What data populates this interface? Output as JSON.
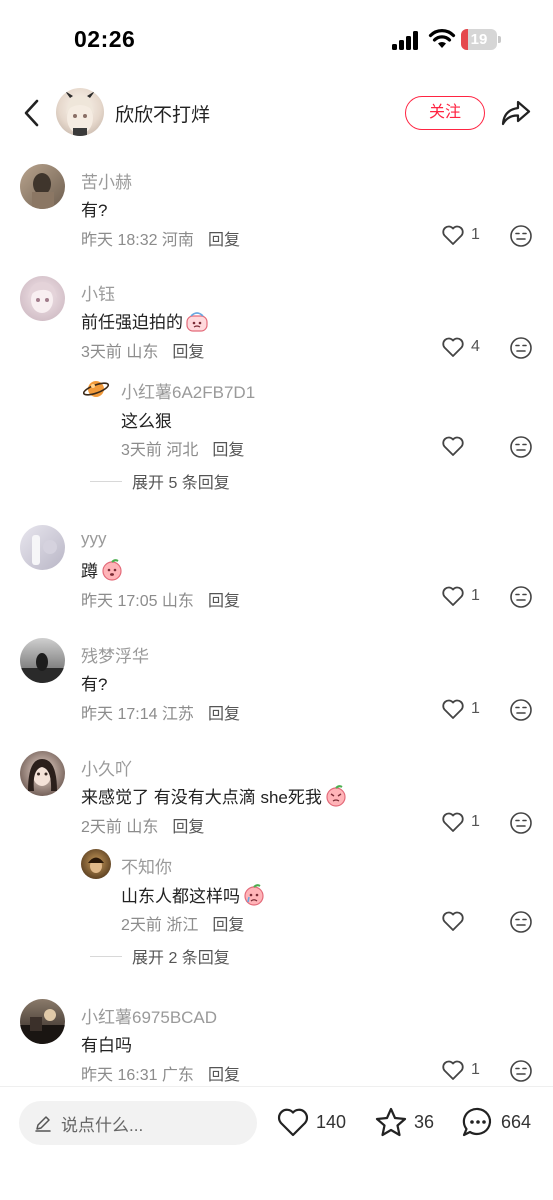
{
  "status": {
    "time": "02:26",
    "battery": "19",
    "battery_level": 0.19
  },
  "header": {
    "name": "欣欣不打烊",
    "follow_label": "关注"
  },
  "comments": [
    {
      "name": "苦小赫",
      "text": "有?",
      "meta": "昨天 18:32 河南",
      "reply_label": "回复",
      "likes": "1"
    },
    {
      "name": "小钰",
      "text": "前任强迫拍的",
      "meta": "3天前 山东",
      "reply_label": "回复",
      "likes": "4",
      "sub": {
        "name": "小红薯6A2FB7D1",
        "text": "这么狠",
        "meta": "3天前 河北",
        "reply_label": "回复"
      },
      "expand": "展开 5 条回复"
    },
    {
      "name": "yyy",
      "text": "蹲",
      "meta": "昨天 17:05 山东",
      "reply_label": "回复",
      "likes": "1"
    },
    {
      "name": "残梦浮华",
      "text": "有?",
      "meta": "昨天 17:14 江苏",
      "reply_label": "回复",
      "likes": "1"
    },
    {
      "name": "小久吖",
      "text": "来感觉了 有没有大点滴 she死我",
      "meta": "2天前 山东",
      "reply_label": "回复",
      "likes": "1",
      "sub": {
        "name": "不知你",
        "text": "山东人都这样吗",
        "meta": "2天前 浙江",
        "reply_label": "回复"
      },
      "expand": "展开 2 条回复"
    },
    {
      "name": "小红薯6975BCAD",
      "text": "有白吗",
      "meta": "昨天 16:31 广东",
      "reply_label": "回复",
      "likes": "1"
    }
  ],
  "bottom": {
    "placeholder": "说点什么...",
    "likes": "140",
    "stars": "36",
    "comments": "664"
  },
  "colors": {
    "accent": "#ff2442",
    "battery_low": "#e5484d"
  }
}
